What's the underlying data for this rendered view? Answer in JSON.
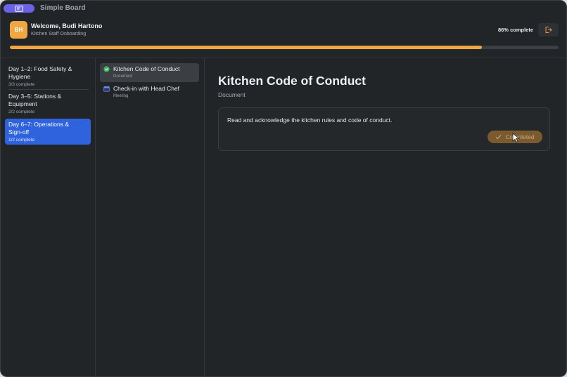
{
  "app": {
    "title": "Simple Board",
    "accent_color": "#6c62e8",
    "icon": "board-icon"
  },
  "header": {
    "avatar_initials": "BH",
    "welcome": "Welcome, Budi Hartono",
    "subtitle": "Kitchen Staff Onboarding",
    "progress_text": "86% complete",
    "progress_value": 0.86,
    "progress_color": "#f0a742",
    "logout_icon": "logout-icon"
  },
  "days": [
    {
      "label": "Day 1–2: Food Safety & Hygiene",
      "status": "3/3 complete",
      "active": false
    },
    {
      "label": "Day 3–5: Stations & Equipment",
      "status": "2/2 complete",
      "active": false
    },
    {
      "label": "Day 6–7: Operations & Sign-off",
      "status": "1/2 complete",
      "active": true
    }
  ],
  "tasks": [
    {
      "title": "Kitchen Code of Conduct",
      "type": "Document",
      "icon": "check-circle-icon",
      "active": true
    },
    {
      "title": "Check-in with Head Chef",
      "type": "Meeting",
      "icon": "calendar-icon",
      "active": false
    }
  ],
  "detail": {
    "title": "Kitchen Code of Conduct",
    "type": "Document",
    "description": "Read and acknowledge the kitchen rules and code of conduct.",
    "completed_label": "Completed",
    "completed_color": "#7a5a2e"
  }
}
